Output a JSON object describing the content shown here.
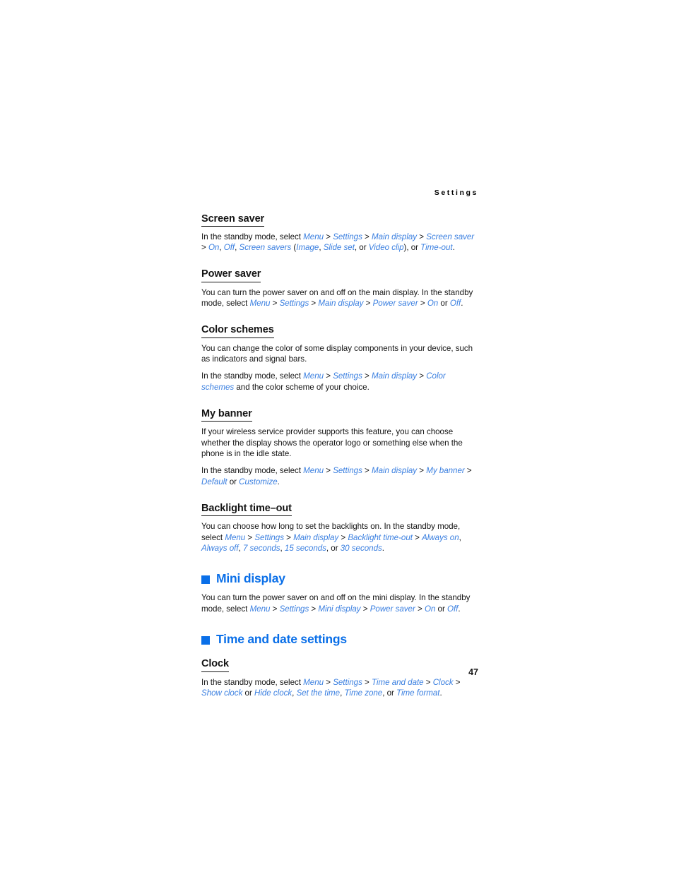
{
  "page": {
    "running_head": "Settings",
    "folio": "47",
    "accent_color": "#0a6fe8",
    "link_color": "#3a7fe0",
    "text_color": "#141414"
  },
  "sections": [
    {
      "id": "screen-saver",
      "level": "sub",
      "heading": "Screen saver",
      "paragraphs": [
        {
          "runs": [
            {
              "t": "In the standby mode, select ",
              "k": "plain"
            },
            {
              "t": "Menu",
              "k": "link"
            },
            {
              "t": " > ",
              "k": "plain"
            },
            {
              "t": "Settings",
              "k": "link"
            },
            {
              "t": " > ",
              "k": "plain"
            },
            {
              "t": "Main display",
              "k": "link"
            },
            {
              "t": " > ",
              "k": "plain"
            },
            {
              "t": "Screen saver",
              "k": "link"
            },
            {
              "t": " > ",
              "k": "plain"
            },
            {
              "t": "On",
              "k": "link"
            },
            {
              "t": ", ",
              "k": "plain"
            },
            {
              "t": "Off",
              "k": "link"
            },
            {
              "t": ", ",
              "k": "plain"
            },
            {
              "t": "Screen savers",
              "k": "link"
            },
            {
              "t": " (",
              "k": "plain"
            },
            {
              "t": "Image",
              "k": "link"
            },
            {
              "t": ", ",
              "k": "plain"
            },
            {
              "t": "Slide set",
              "k": "link"
            },
            {
              "t": ", or ",
              "k": "plain"
            },
            {
              "t": "Video clip",
              "k": "link"
            },
            {
              "t": "), or ",
              "k": "plain"
            },
            {
              "t": "Time-out",
              "k": "link"
            },
            {
              "t": ".",
              "k": "plain"
            }
          ]
        }
      ]
    },
    {
      "id": "power-saver",
      "level": "sub",
      "heading": "Power saver",
      "paragraphs": [
        {
          "runs": [
            {
              "t": "You can turn the power saver on and off on the main display. In the standby mode, select ",
              "k": "plain"
            },
            {
              "t": "Menu",
              "k": "link"
            },
            {
              "t": " > ",
              "k": "plain"
            },
            {
              "t": "Settings",
              "k": "link"
            },
            {
              "t": " > ",
              "k": "plain"
            },
            {
              "t": "Main display",
              "k": "link"
            },
            {
              "t": " > ",
              "k": "plain"
            },
            {
              "t": "Power saver",
              "k": "link"
            },
            {
              "t": " > ",
              "k": "plain"
            },
            {
              "t": "On",
              "k": "link"
            },
            {
              "t": " or ",
              "k": "plain"
            },
            {
              "t": "Off",
              "k": "link"
            },
            {
              "t": ".",
              "k": "plain"
            }
          ]
        }
      ]
    },
    {
      "id": "color-schemes",
      "level": "sub",
      "heading": "Color schemes",
      "paragraphs": [
        {
          "runs": [
            {
              "t": "You can change the color of some display components in your device, such as indicators and signal bars.",
              "k": "plain"
            }
          ]
        },
        {
          "runs": [
            {
              "t": "In the standby mode, select ",
              "k": "plain"
            },
            {
              "t": "Menu",
              "k": "link"
            },
            {
              "t": " > ",
              "k": "plain"
            },
            {
              "t": "Settings",
              "k": "link"
            },
            {
              "t": " > ",
              "k": "plain"
            },
            {
              "t": "Main display",
              "k": "link"
            },
            {
              "t": " > ",
              "k": "plain"
            },
            {
              "t": "Color schemes",
              "k": "link"
            },
            {
              "t": " and the color scheme of your choice.",
              "k": "plain"
            }
          ]
        }
      ]
    },
    {
      "id": "my-banner",
      "level": "sub",
      "heading": "My banner",
      "paragraphs": [
        {
          "runs": [
            {
              "t": "If your wireless service provider supports this feature, you can choose whether the display shows the operator logo or something else when the phone is in the idle state.",
              "k": "plain"
            }
          ]
        },
        {
          "runs": [
            {
              "t": "In the standby mode, select ",
              "k": "plain"
            },
            {
              "t": "Menu",
              "k": "link"
            },
            {
              "t": " > ",
              "k": "plain"
            },
            {
              "t": "Settings",
              "k": "link"
            },
            {
              "t": " > ",
              "k": "plain"
            },
            {
              "t": "Main display",
              "k": "link"
            },
            {
              "t": " > ",
              "k": "plain"
            },
            {
              "t": "My banner",
              "k": "link"
            },
            {
              "t": " > ",
              "k": "plain"
            },
            {
              "t": "Default",
              "k": "link"
            },
            {
              "t": " or ",
              "k": "plain"
            },
            {
              "t": "Customize",
              "k": "link"
            },
            {
              "t": ".",
              "k": "plain"
            }
          ]
        }
      ]
    },
    {
      "id": "backlight-time-out",
      "level": "sub",
      "heading": "Backlight time–out",
      "paragraphs": [
        {
          "runs": [
            {
              "t": "You can choose how long to set the backlights on. In the standby mode, select ",
              "k": "plain"
            },
            {
              "t": "Menu",
              "k": "link"
            },
            {
              "t": " > ",
              "k": "plain"
            },
            {
              "t": "Settings",
              "k": "link"
            },
            {
              "t": " > ",
              "k": "plain"
            },
            {
              "t": "Main display",
              "k": "link"
            },
            {
              "t": " > ",
              "k": "plain"
            },
            {
              "t": "Backlight time-out",
              "k": "link"
            },
            {
              "t": " > ",
              "k": "plain"
            },
            {
              "t": "Always on",
              "k": "link"
            },
            {
              "t": ", ",
              "k": "plain"
            },
            {
              "t": "Always off",
              "k": "link"
            },
            {
              "t": ", ",
              "k": "plain"
            },
            {
              "t": "7 seconds",
              "k": "link"
            },
            {
              "t": ", ",
              "k": "plain"
            },
            {
              "t": "15 seconds",
              "k": "link"
            },
            {
              "t": ", or ",
              "k": "plain"
            },
            {
              "t": "30 seconds",
              "k": "link"
            },
            {
              "t": ".",
              "k": "plain"
            }
          ]
        }
      ]
    },
    {
      "id": "mini-display",
      "level": "blue",
      "heading": "Mini display",
      "paragraphs": [
        {
          "runs": [
            {
              "t": "You can turn the power saver on and off on the mini display. In the standby mode, select ",
              "k": "plain"
            },
            {
              "t": "Menu",
              "k": "link"
            },
            {
              "t": " > ",
              "k": "plain"
            },
            {
              "t": "Settings",
              "k": "link"
            },
            {
              "t": " > ",
              "k": "plain"
            },
            {
              "t": "Mini display",
              "k": "link"
            },
            {
              "t": " > ",
              "k": "plain"
            },
            {
              "t": "Power saver",
              "k": "link"
            },
            {
              "t": " > ",
              "k": "plain"
            },
            {
              "t": "On",
              "k": "link"
            },
            {
              "t": " or ",
              "k": "plain"
            },
            {
              "t": "Off",
              "k": "link"
            },
            {
              "t": ".",
              "k": "plain"
            }
          ]
        }
      ]
    },
    {
      "id": "time-and-date-settings",
      "level": "blue",
      "heading": "Time and date settings",
      "paragraphs": []
    },
    {
      "id": "clock",
      "level": "sub",
      "heading": "Clock",
      "paragraphs": [
        {
          "runs": [
            {
              "t": "In the standby mode, select ",
              "k": "plain"
            },
            {
              "t": "Menu",
              "k": "link"
            },
            {
              "t": " > ",
              "k": "plain"
            },
            {
              "t": "Settings",
              "k": "link"
            },
            {
              "t": " > ",
              "k": "plain"
            },
            {
              "t": "Time and date",
              "k": "link"
            },
            {
              "t": " > ",
              "k": "plain"
            },
            {
              "t": "Clock",
              "k": "link"
            },
            {
              "t": " > ",
              "k": "plain"
            },
            {
              "t": "Show clock",
              "k": "link"
            },
            {
              "t": " or ",
              "k": "plain"
            },
            {
              "t": "Hide clock",
              "k": "link"
            },
            {
              "t": ", ",
              "k": "plain"
            },
            {
              "t": "Set the time",
              "k": "link"
            },
            {
              "t": ", ",
              "k": "plain"
            },
            {
              "t": "Time zone",
              "k": "link"
            },
            {
              "t": ", or ",
              "k": "plain"
            },
            {
              "t": "Time format",
              "k": "link"
            },
            {
              "t": ".",
              "k": "plain"
            }
          ]
        }
      ]
    }
  ]
}
